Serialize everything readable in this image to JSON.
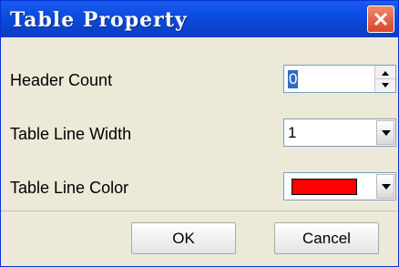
{
  "window": {
    "title": "Table Property"
  },
  "form": {
    "header_count": {
      "label": "Header Count",
      "value": "0"
    },
    "line_width": {
      "label": "Table Line Width",
      "value": "1"
    },
    "line_color": {
      "label": "Table Line Color",
      "color": "#ff0000"
    }
  },
  "buttons": {
    "ok": "OK",
    "cancel": "Cancel"
  }
}
